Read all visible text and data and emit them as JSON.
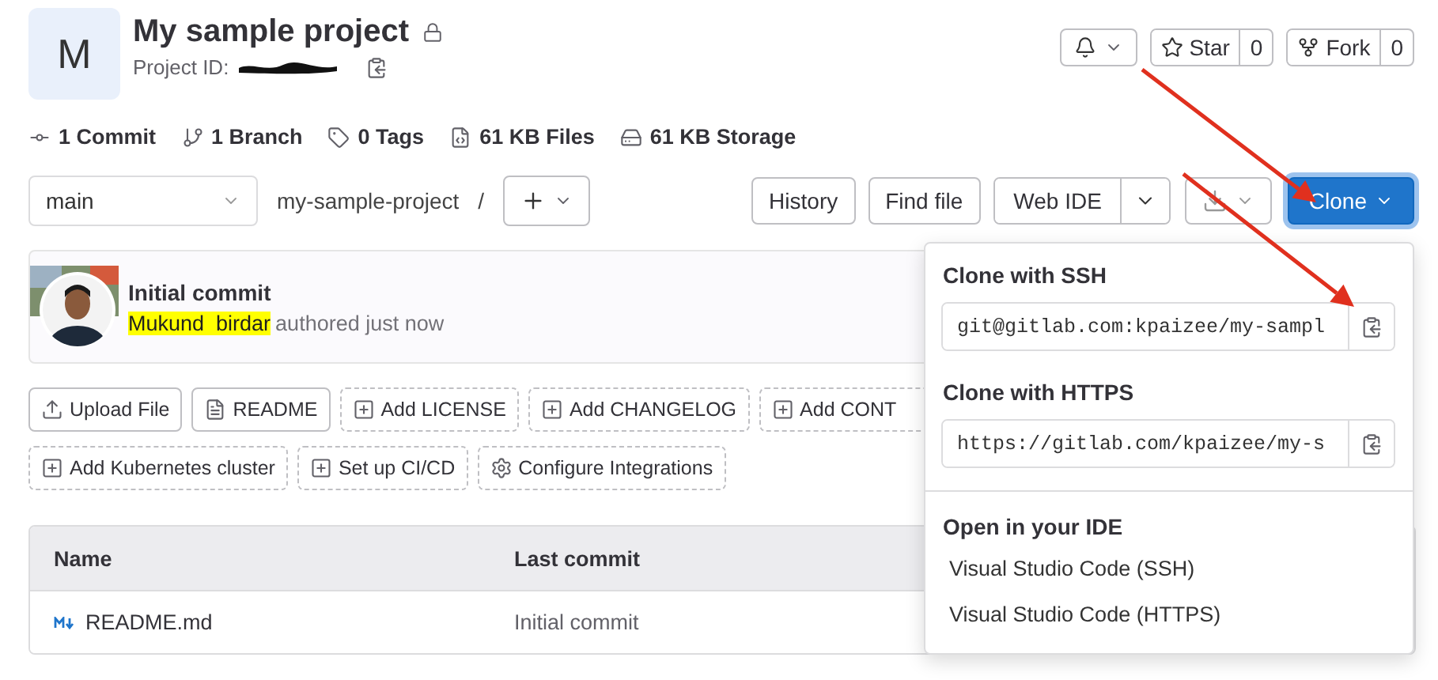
{
  "project": {
    "avatar_letter": "M",
    "title": "My sample project",
    "private": true,
    "id_label": "Project ID:"
  },
  "header_actions": {
    "star": {
      "label": "Star",
      "count": "0"
    },
    "fork": {
      "label": "Fork",
      "count": "0"
    }
  },
  "stats": [
    {
      "kind": "commit",
      "label": "1 Commit"
    },
    {
      "kind": "branch",
      "label": "1 Branch"
    },
    {
      "kind": "tag",
      "label": "0 Tags"
    },
    {
      "kind": "files",
      "label": "61 KB Files"
    },
    {
      "kind": "storage",
      "label": "61 KB Storage"
    }
  ],
  "toolbar": {
    "branch": "main",
    "path": "my-sample-project",
    "separator": "/",
    "buttons": [
      "History",
      "Find file"
    ],
    "web_ide": "Web IDE",
    "clone": "Clone"
  },
  "last_commit": {
    "title": "Initial commit",
    "author": "Mukund  birdar",
    "meta": "authored just now"
  },
  "actions": [
    {
      "kind": "upload",
      "label": "Upload File",
      "dashed": false
    },
    {
      "kind": "readme",
      "label": "README",
      "dashed": false
    },
    {
      "kind": "add",
      "label": "Add LICENSE",
      "dashed": true
    },
    {
      "kind": "add",
      "label": "Add CHANGELOG",
      "dashed": true
    },
    {
      "kind": "add",
      "label": "Add CONT",
      "dashed": true
    },
    {
      "kind": "add",
      "label": "Add Kubernetes cluster",
      "dashed": true
    },
    {
      "kind": "add",
      "label": "Set up CI/CD",
      "dashed": true
    },
    {
      "kind": "settings",
      "label": "Configure Integrations",
      "dashed": true
    }
  ],
  "table": {
    "columns": [
      "Name",
      "Last commit"
    ],
    "rows": [
      {
        "name": "README.md",
        "last_commit": "Initial commit"
      }
    ]
  },
  "clone_menu": {
    "ssh_heading": "Clone with SSH",
    "ssh_url": "git@gitlab.com:kpaizee/my-sampl",
    "https_heading": "Clone with HTTPS",
    "https_url": "https://gitlab.com/kpaizee/my-s",
    "ide_heading": "Open in your IDE",
    "ide_options": [
      "Visual Studio Code (SSH)",
      "Visual Studio Code (HTTPS)"
    ]
  }
}
